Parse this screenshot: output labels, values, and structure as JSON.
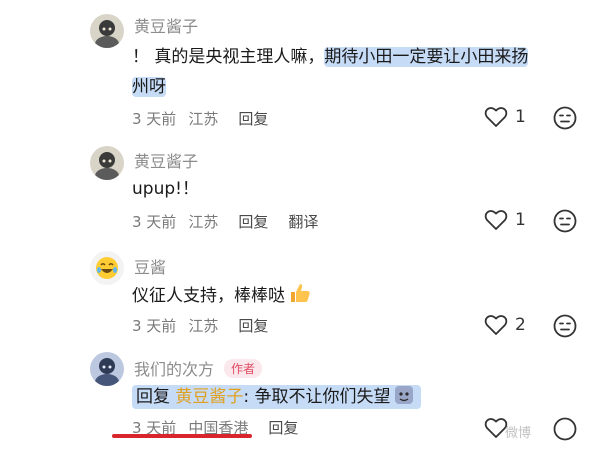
{
  "comments": [
    {
      "username": "黄豆酱子",
      "text_plain": "！ 真的是央视主理人嘛，",
      "text_hl_1": "期待小田一定要让小田来扬",
      "text_hl_2": "州呀",
      "time": "3 天前",
      "location": "江苏",
      "reply": "回复",
      "likes": "1",
      "avatar_icon": "avatar-illustration-icon"
    },
    {
      "username": "黄豆酱子",
      "text": "upup!！",
      "time": "3 天前",
      "location": "江苏",
      "reply": "回复",
      "translate": "翻译",
      "likes": "1",
      "avatar_icon": "avatar-illustration-icon"
    },
    {
      "username": "豆酱",
      "text": "仪征人支持，棒棒哒",
      "emoji": "thumbs-up-emoji",
      "time": "3 天前",
      "location": "江苏",
      "reply": "回复",
      "likes": "2",
      "avatar_icon": "laughing-emoji-icon"
    },
    {
      "username": "我们的次方",
      "author_badge": "作者",
      "reply_prefix": "回复",
      "reply_to": "黄豆酱子",
      "text": ": 争取不让你们失望",
      "time": "3 天前",
      "location": "中国香港",
      "reply": "回复",
      "avatar_icon": "avatar-illustration-icon"
    }
  ],
  "colors": {
    "highlight": "#c6dbf6",
    "author_badge": "#e04b63",
    "underline": "#d8262c",
    "reply_to": "#e0a020"
  },
  "watermark": "微博"
}
